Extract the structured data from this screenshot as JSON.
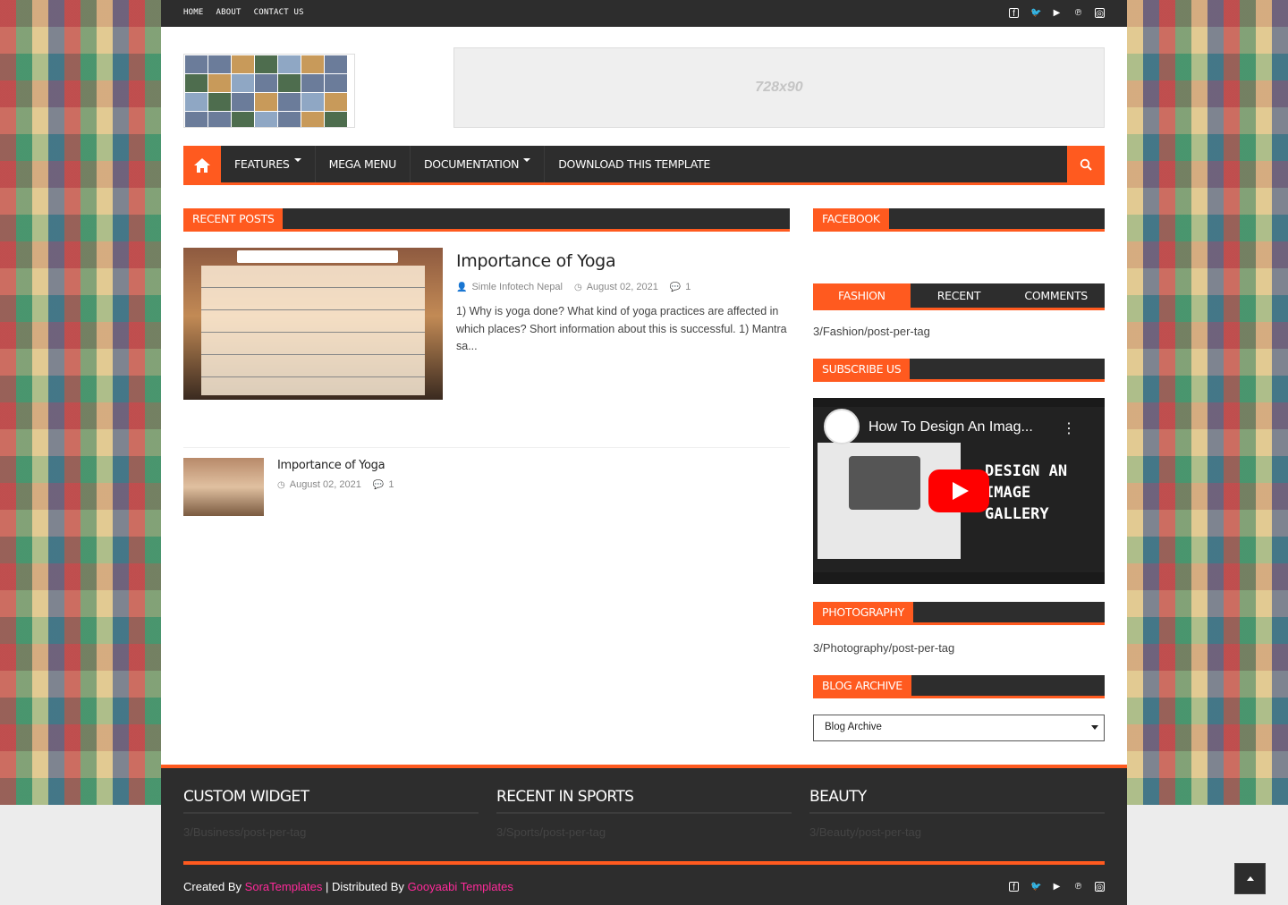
{
  "topbar": {
    "links": [
      "HOME",
      "ABOUT",
      "CONTACT US"
    ],
    "social_icons": [
      "facebook-icon",
      "twitter-icon",
      "youtube-icon",
      "pinterest-icon",
      "instagram-icon"
    ]
  },
  "ad": {
    "text": "728x90"
  },
  "mainnav": {
    "items": [
      {
        "label": "FEATURES",
        "dropdown": true
      },
      {
        "label": "MEGA MENU",
        "dropdown": false
      },
      {
        "label": "DOCUMENTATION",
        "dropdown": true
      },
      {
        "label": "DOWNLOAD THIS TEMPLATE",
        "dropdown": false
      }
    ]
  },
  "recent_posts": {
    "heading": "RECENT POSTS",
    "featured": {
      "title": "Importance of Yoga",
      "author": "Simle Infotech Nepal",
      "date": "August 02, 2021",
      "comments": "1",
      "excerpt": "1) Why is yoga done? What kind of yoga practices are affected in which places? Short information about this is successful. 1) Mantra sa..."
    },
    "list": [
      {
        "title": "Importance of Yoga",
        "date": "August 02, 2021",
        "comments": "1"
      }
    ]
  },
  "sidebar": {
    "facebook_heading": "FACEBOOK",
    "tabs": [
      "FASHION",
      "RECENT",
      "COMMENTS"
    ],
    "active_tab": "FASHION",
    "fashion_text": "3/Fashion/post-per-tag",
    "subscribe_heading": "SUBSCRIBE US",
    "video": {
      "title": "How To Design An Imag...",
      "overlay": [
        "DESIGN AN",
        "IMAGE",
        "GALLERY"
      ]
    },
    "photography_heading": "PHOTOGRAPHY",
    "photography_text": "3/Photography/post-per-tag",
    "archive_heading": "BLOG ARCHIVE",
    "archive_select": "Blog Archive"
  },
  "footer": {
    "columns": [
      {
        "heading": "CUSTOM WIDGET",
        "text": "3/Business/post-per-tag"
      },
      {
        "heading": "RECENT IN SPORTS",
        "text": "3/Sports/post-per-tag"
      },
      {
        "heading": "BEAUTY",
        "text": "3/Beauty/post-per-tag"
      }
    ],
    "credits": {
      "created_by": "Created By",
      "creator": "SoraTemplates",
      "distributed_by": "| Distributed By",
      "distributor": "Gooyaabi Templates"
    }
  },
  "colors": {
    "accent": "#ff5a1f",
    "dark": "#2d2d2d",
    "link": "#ff2a9a"
  }
}
